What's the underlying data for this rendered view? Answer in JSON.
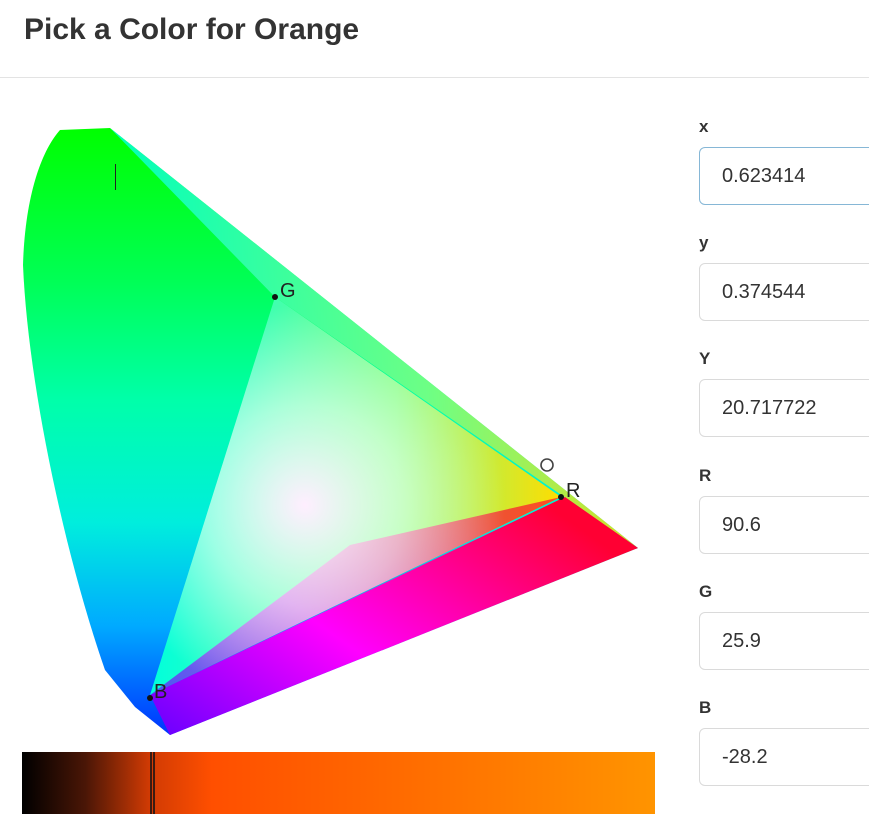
{
  "header": {
    "title": "Pick a Color for Orange"
  },
  "diagram": {
    "primaries": {
      "red": "R",
      "green": "G",
      "blue": "B"
    },
    "colors": {
      "green": "#00ff00",
      "red": "#ff0033",
      "blue": "#6600ff",
      "cyan": "#00ffee",
      "white_point": "#ffeeff"
    }
  },
  "slider": {
    "colors": [
      "#000000",
      "#cf3a04",
      "#ff6600",
      "#ff9400"
    ]
  },
  "fields": [
    {
      "label": "x",
      "value": "0.623414"
    },
    {
      "label": "y",
      "value": "0.374544"
    },
    {
      "label": "Y",
      "value": "20.717722"
    },
    {
      "label": "R",
      "value": "90.6"
    },
    {
      "label": "G",
      "value": "25.9"
    },
    {
      "label": "B",
      "value": "-28.2"
    }
  ]
}
